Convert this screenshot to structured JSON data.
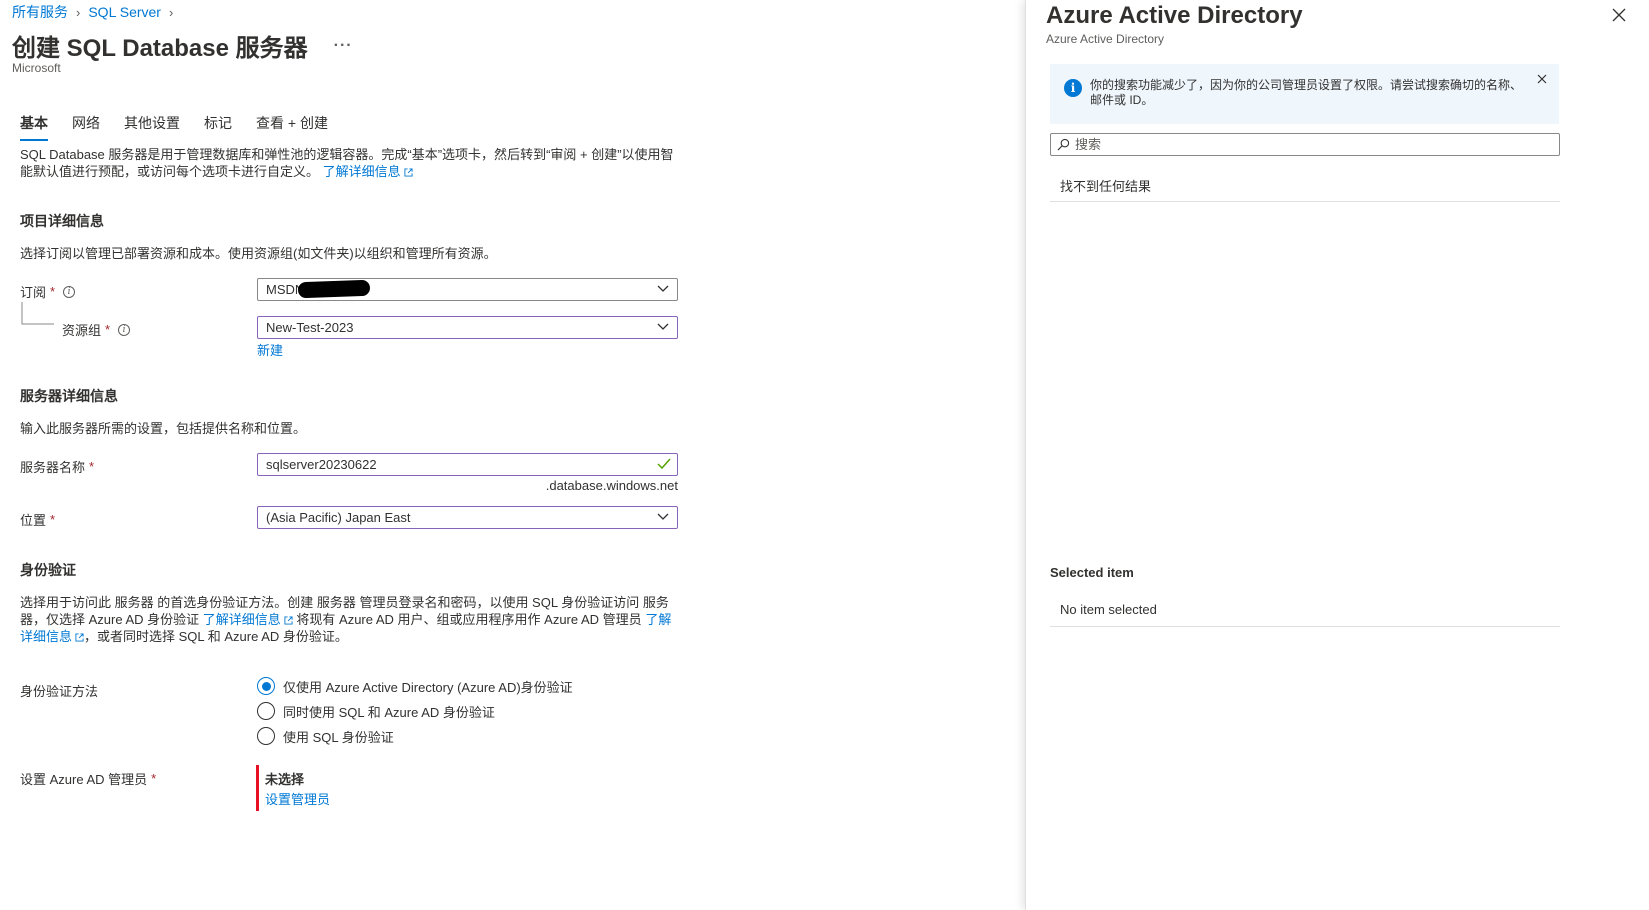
{
  "breadcrumb": {
    "items": [
      "所有服务",
      "SQL Server"
    ]
  },
  "page": {
    "title": "创建 SQL Database 服务器",
    "more": "···",
    "publisher": "Microsoft"
  },
  "tabs": [
    {
      "label": "基本",
      "active": true
    },
    {
      "label": "网络",
      "active": false
    },
    {
      "label": "其他设置",
      "active": false
    },
    {
      "label": "标记",
      "active": false
    },
    {
      "label": "查看 + 创建",
      "active": false
    }
  ],
  "intro": {
    "text": "SQL Database 服务器是用于管理数据库和弹性池的逻辑容器。完成“基本”选项卡，然后转到“审阅 + 创建”以使用智能默认值进行预配，或访问每个选项卡进行自定义。",
    "learn_more": "了解详细信息"
  },
  "project": {
    "title": "项目详细信息",
    "desc": "选择订阅以管理已部署资源和成本。使用资源组(如文件夹)以组织和管理所有资源。",
    "subscription_label": "订阅",
    "subscription_value": "MSDN",
    "resource_group_label": "资源组",
    "resource_group_value": "New-Test-2023",
    "create_new": "新建"
  },
  "server": {
    "title": "服务器详细信息",
    "desc": "输入此服务器所需的设置，包括提供名称和位置。",
    "name_label": "服务器名称",
    "name_value": "sqlserver20230622",
    "name_suffix": ".database.windows.net",
    "location_label": "位置",
    "location_value": "(Asia Pacific) Japan East"
  },
  "auth": {
    "title": "身份验证",
    "desc_1": "选择用于访问此 服务器 的首选身份验证方法。创建 服务器 管理员登录名和密码，以使用 SQL 身份验证访问 服务器，仅选择 Azure AD 身份验证",
    "learn_more_1": "了解详细信息",
    "desc_2": "将现有 Azure AD 用户、组或应用程序用作 Azure AD 管理员",
    "learn_more_2": "了解详细信息",
    "desc_3": "，或者同时选择 SQL 和 Azure AD 身份验证。",
    "method_label": "身份验证方法",
    "options": [
      {
        "label": "仅使用 Azure Active Directory (Azure AD)身份验证",
        "checked": true
      },
      {
        "label": "同时使用 SQL 和 Azure AD 身份验证",
        "checked": false
      },
      {
        "label": "使用 SQL 身份验证",
        "checked": false
      }
    ],
    "admin_label": "设置 Azure AD 管理员",
    "admin_value": "未选择",
    "admin_link": "设置管理员"
  },
  "panel": {
    "title": "Azure Active Directory",
    "subtitle": "Azure Active Directory",
    "notice": "你的搜索功能减少了，因为你的公司管理员设置了权限。请尝试搜索确切的名称、邮件或 ID。",
    "search_placeholder": "搜索",
    "no_results": "找不到任何结果",
    "selected_title": "Selected item",
    "selected_value": "No item selected"
  },
  "colors": {
    "accent": "#0078d4",
    "required": "#a4262c",
    "error_bar": "#e81123",
    "valid_check": "#57a300",
    "focus_border": "#8764b8"
  }
}
